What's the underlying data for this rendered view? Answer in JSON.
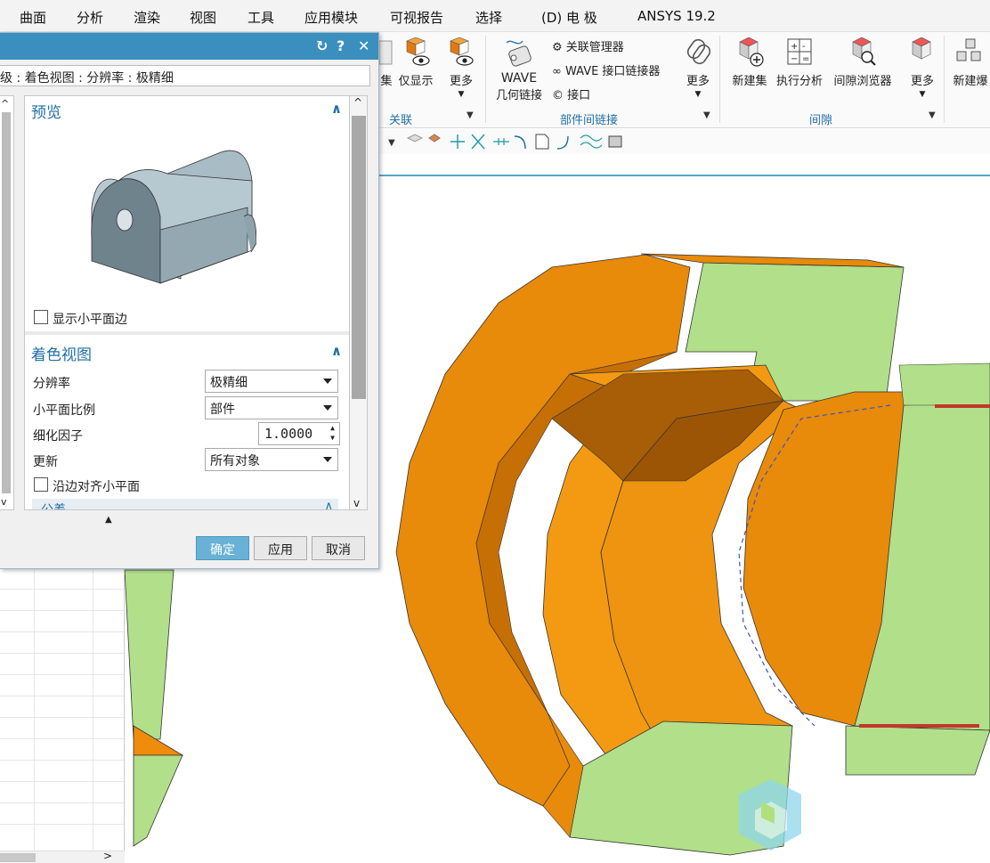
{
  "menu": [
    "曲面",
    "分析",
    "渲染",
    "视图",
    "工具",
    "应用模块",
    "可视报告",
    "选择",
    "(D) 电  极",
    "ANSYS 19.2"
  ],
  "ribbon": {
    "assoc_group": {
      "label": "关联",
      "buttons": [
        {
          "label": "集",
          "icon": "set-icon"
        },
        {
          "label": "仅显示",
          "icon": "show-only-icon"
        },
        {
          "label": "更多",
          "icon": "more-icon"
        }
      ]
    },
    "interpart_group": {
      "label": "部件间链接",
      "wave_label_1": "WAVE",
      "wave_label_2": "几何链接",
      "items": [
        "关联管理器",
        "WAVE 接口链接器",
        "接口"
      ],
      "more": "更多"
    },
    "clearance_group": {
      "label": "间隙",
      "buttons": [
        "新建集",
        "执行分析",
        "间隙浏览器",
        "更多"
      ]
    },
    "extra_button": "新建爆"
  },
  "dialog": {
    "path": "级 : 着色视图 : 分辨率 : 极精细",
    "preview": {
      "title": "预览",
      "show_facet_edges": "显示小平面边"
    },
    "shaded_view": {
      "title": "着色视图",
      "fields": [
        {
          "label": "分辨率",
          "value": "极精细"
        },
        {
          "label": "小平面比例",
          "value": "部件"
        },
        {
          "label": "细化因子",
          "value": "1.0000"
        },
        {
          "label": "更新",
          "value": "所有对象"
        }
      ],
      "align_facets": "沿边对齐小平面"
    },
    "next_section": "公差",
    "buttons": {
      "ok": "确定",
      "apply": "应用",
      "cancel": "取消"
    }
  },
  "colors": {
    "accent": "#3a8fbf",
    "orange": "#e88a0a",
    "green": "#b2df8a",
    "red_stripe": "#c0392b"
  }
}
